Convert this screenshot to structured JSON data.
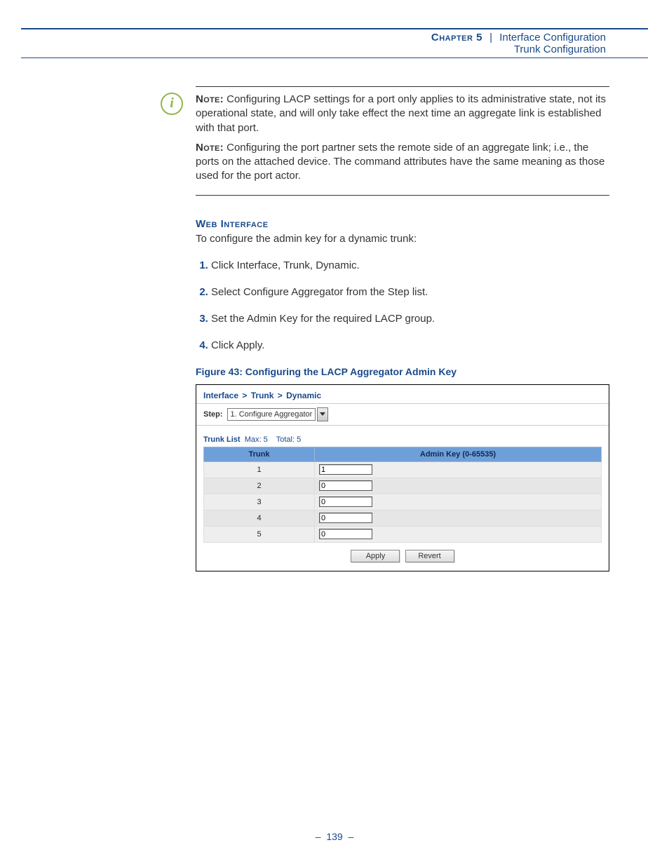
{
  "header": {
    "chapter": "Chapter 5",
    "pipe": "|",
    "section": "Interface Configuration",
    "subsection": "Trunk Configuration"
  },
  "info_icon_glyph": "i",
  "notes": {
    "label": "Note:",
    "p1": "Configuring LACP settings for a port only applies to its administrative state, not its operational state, and will only take effect the next time an aggregate link is established with that port.",
    "p2": "Configuring the port partner sets the remote side of an aggregate link; i.e., the ports on the attached device. The command attributes have the same meaning as those used for the port actor."
  },
  "web_interface": {
    "heading": "Web Interface",
    "intro": "To configure the admin key for a dynamic trunk:",
    "steps": [
      "Click Interface, Trunk, Dynamic.",
      "Select Configure Aggregator from the Step list.",
      "Set the Admin Key for the required LACP group.",
      "Click Apply."
    ]
  },
  "figure_caption": "Figure 43:  Configuring the LACP Aggregator Admin Key",
  "screenshot": {
    "breadcrumb": {
      "a": "Interface",
      "sep": ">",
      "b": "Trunk",
      "c": "Dynamic"
    },
    "step_label": "Step:",
    "step_value": "1. Configure Aggregator",
    "list_meta": {
      "label": "Trunk List",
      "max_label": "Max:",
      "max_value": "5",
      "total_label": "Total:",
      "total_value": "5"
    },
    "columns": {
      "trunk": "Trunk",
      "admin": "Admin Key (0-65535)"
    },
    "rows": [
      {
        "trunk": "1",
        "admin": "1"
      },
      {
        "trunk": "2",
        "admin": "0"
      },
      {
        "trunk": "3",
        "admin": "0"
      },
      {
        "trunk": "4",
        "admin": "0"
      },
      {
        "trunk": "5",
        "admin": "0"
      }
    ],
    "buttons": {
      "apply": "Apply",
      "revert": "Revert"
    }
  },
  "footer": {
    "dash": "–",
    "page": "139"
  }
}
